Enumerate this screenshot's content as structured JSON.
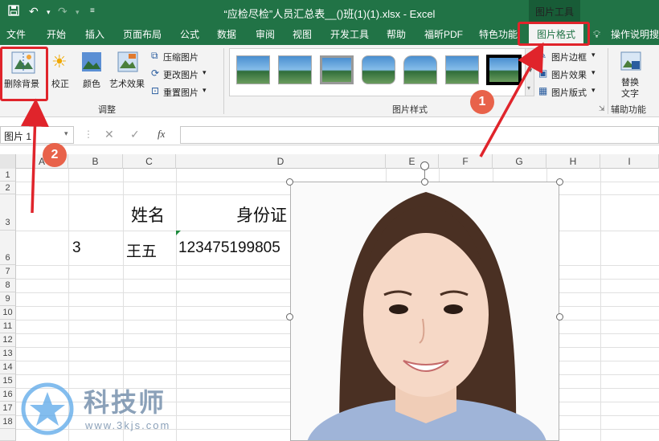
{
  "titlebar": {
    "title": "“应检尽检”人员汇总表__()班(1)(1).xlsx  -  Excel",
    "tools_label": "图片工具"
  },
  "tabs": [
    "文件",
    "开始",
    "插入",
    "页面布局",
    "公式",
    "数据",
    "审阅",
    "视图",
    "开发工具",
    "帮助",
    "福昕PDF",
    "特色功能"
  ],
  "active_tab": "图片格式",
  "tell_me": "操作说明搜",
  "ribbon": {
    "remove_bg": "删除背景",
    "correct": "校正",
    "color": "颜色",
    "art_effect": "艺术效果",
    "compress": "压缩图片",
    "change": "更改图片",
    "reset": "重置图片",
    "group_adjust": "调整",
    "group_styles": "图片样式",
    "border": "图片边框",
    "effect": "图片效果",
    "layout": "图片版式",
    "alt_text_1": "替换",
    "alt_text_2": "文字",
    "group_assist": "辅助功能"
  },
  "formula_bar": {
    "name_box": "图片 1",
    "fx": "fx"
  },
  "columns": [
    "A",
    "B",
    "C",
    "D",
    "E",
    "F",
    "G",
    "H",
    "I"
  ],
  "rows": [
    "1",
    "2",
    "3",
    "6",
    "7",
    "8",
    "9",
    "10",
    "11",
    "12",
    "13",
    "14",
    "15",
    "16",
    "17",
    "18"
  ],
  "cells": {
    "c3": "姓名",
    "d3": "身份证",
    "b6": "3",
    "c6": "王五",
    "d6": "123475199805"
  },
  "annotations": {
    "badge1": "1",
    "badge2": "2"
  },
  "watermark": {
    "brand": "科技师",
    "url": "www.3kjs.com"
  },
  "colors": {
    "excel_green": "#217346",
    "annotation_red": "#e0242b",
    "badge_orange": "#e8624a"
  }
}
